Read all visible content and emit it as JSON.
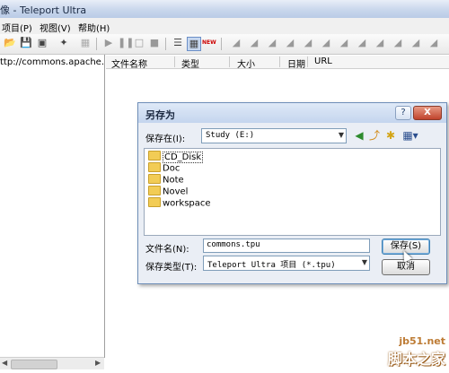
{
  "window": {
    "title": "像 - Teleport Ultra",
    "menu": [
      "项目(P)",
      "视图(V)",
      "帮助(H)"
    ],
    "left_url": "ttp://commons.apache.org/",
    "columns": [
      "文件名称",
      "类型",
      "大小",
      "日期",
      "URL"
    ]
  },
  "toolbar": {
    "icons": [
      "open-icon",
      "save-icon",
      "properties-icon",
      "new-project-icon",
      "disabled-icon",
      "play-icon",
      "pause-icon",
      "stop-icon",
      "stop-all-icon",
      "list-view-icon",
      "grid-view-icon",
      "new-icon"
    ],
    "new_badge": "NEW"
  },
  "dialog": {
    "title": "另存为",
    "help": "?",
    "close": "X",
    "save_in_label": "保存在(I):",
    "save_in_value": "Study (E:)",
    "files": [
      "CD_Disk",
      "Doc",
      "Note",
      "Novel",
      "workspace"
    ],
    "filename_label": "文件名(N):",
    "filename_value": "commons.tpu",
    "filetype_label": "保存类型(T):",
    "filetype_value": "Teleport Ultra 项目 (*.tpu)",
    "save_button": "保存(S)",
    "cancel_button": "取消"
  },
  "watermark": {
    "line1": "jb51.net",
    "line2": "脚本之家"
  }
}
